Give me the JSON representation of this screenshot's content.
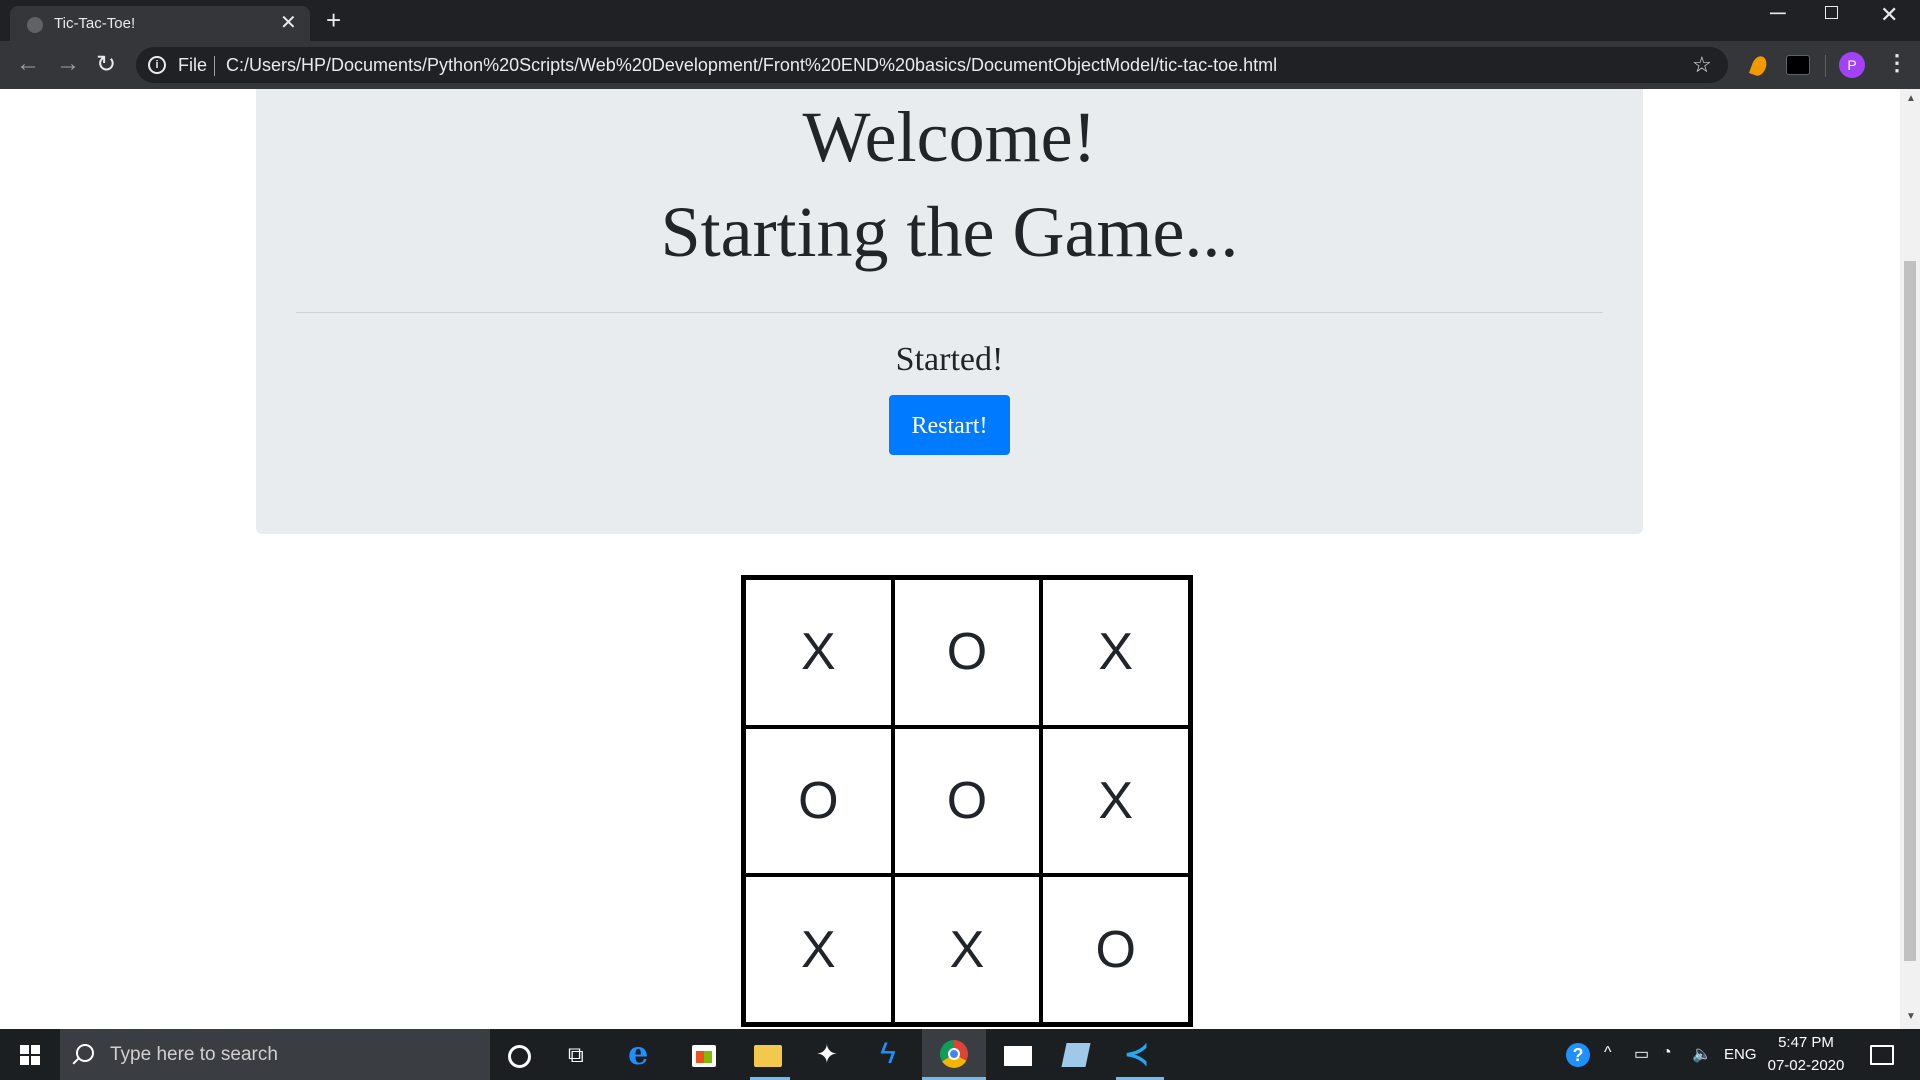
{
  "browser": {
    "tab_title": "Tic-Tac-Toe!",
    "tab_close": "✕",
    "new_tab": "+",
    "scheme_label": "File",
    "url": "C:/Users/HP/Documents/Python%20Scripts/Web%20Development/Front%20END%20basics/DocumentObjectModel/tic-tac-toe.html",
    "profile_initial": "P"
  },
  "page": {
    "heading_line1": "Welcome!",
    "heading_line2": "Starting the Game...",
    "status": "Started!",
    "restart_label": "Restart!",
    "board": [
      [
        "X",
        "O",
        "X"
      ],
      [
        "O",
        "O",
        "X"
      ],
      [
        "X",
        "X",
        "O"
      ]
    ],
    "accent_color": "#007bff",
    "jumbotron_color": "#e9ecef"
  },
  "taskbar": {
    "search_placeholder": "Type here to search",
    "language": "ENG",
    "time": "5:47 PM",
    "date": "07-02-2020"
  }
}
